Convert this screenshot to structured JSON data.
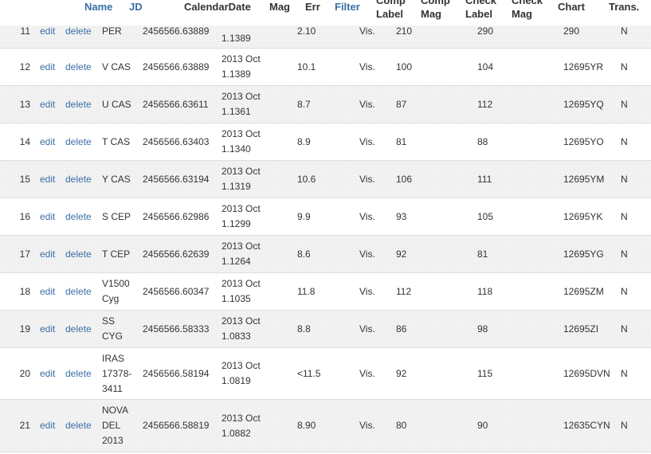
{
  "columns": {
    "name": "Name",
    "jd": "JD",
    "calendar_date": "CalendarDate",
    "mag": "Mag",
    "err": "Err",
    "filter": "Filter",
    "comp_label": [
      "Comp",
      "Label"
    ],
    "comp_mag": [
      "Comp",
      "Mag"
    ],
    "check_label": [
      "Check",
      "Label"
    ],
    "check_mag": [
      "Check",
      "Mag"
    ],
    "chart": "Chart",
    "trans": "Trans."
  },
  "actions": {
    "edit": "edit",
    "delete": "delete"
  },
  "rows": [
    {
      "num": "11",
      "name": [
        "PER"
      ],
      "jd": "2456566.63889",
      "date": [
        "",
        "1.1389"
      ],
      "mag": "2.10",
      "filter": "Vis.",
      "comp": "210",
      "check": "290",
      "chart": "290",
      "trans": "N"
    },
    {
      "num": "12",
      "name": [
        "V CAS"
      ],
      "jd": "2456566.63889",
      "date": [
        "2013 Oct",
        "1.1389"
      ],
      "mag": "10.1",
      "filter": "Vis.",
      "comp": "100",
      "check": "104",
      "chart": "12695YR",
      "trans": "N"
    },
    {
      "num": "13",
      "name": [
        "U CAS"
      ],
      "jd": "2456566.63611",
      "date": [
        "2013 Oct",
        "1.1361"
      ],
      "mag": "8.7",
      "filter": "Vis.",
      "comp": "87",
      "check": "112",
      "chart": "12695YQ",
      "trans": "N"
    },
    {
      "num": "14",
      "name": [
        "T CAS"
      ],
      "jd": "2456566.63403",
      "date": [
        "2013 Oct",
        "1.1340"
      ],
      "mag": "8.9",
      "filter": "Vis.",
      "comp": "81",
      "check": "88",
      "chart": "12695YO",
      "trans": "N"
    },
    {
      "num": "15",
      "name": [
        "Y CAS"
      ],
      "jd": "2456566.63194",
      "date": [
        "2013 Oct",
        "1.1319"
      ],
      "mag": "10.6",
      "filter": "Vis.",
      "comp": "106",
      "check": "111",
      "chart": "12695YM",
      "trans": "N"
    },
    {
      "num": "16",
      "name": [
        "S CEP"
      ],
      "jd": "2456566.62986",
      "date": [
        "2013 Oct",
        "1.1299"
      ],
      "mag": "9.9",
      "filter": "Vis.",
      "comp": "93",
      "check": "105",
      "chart": "12695YK",
      "trans": "N"
    },
    {
      "num": "17",
      "name": [
        "T CEP"
      ],
      "jd": "2456566.62639",
      "date": [
        "2013 Oct",
        "1.1264"
      ],
      "mag": "8.6",
      "filter": "Vis.",
      "comp": "92",
      "check": "81",
      "chart": "12695YG",
      "trans": "N"
    },
    {
      "num": "18",
      "name": [
        "V1500",
        "Cyg"
      ],
      "jd": "2456566.60347",
      "date": [
        "2013 Oct",
        "1.1035"
      ],
      "mag": "11.8",
      "filter": "Vis.",
      "comp": "112",
      "check": "118",
      "chart": "12695ZM",
      "trans": "N"
    },
    {
      "num": "19",
      "name": [
        "SS",
        "CYG"
      ],
      "jd": "2456566.58333",
      "date": [
        "2013 Oct",
        "1.0833"
      ],
      "mag": "8.8",
      "filter": "Vis.",
      "comp": "86",
      "check": "98",
      "chart": "12695ZI",
      "trans": "N"
    },
    {
      "num": "20",
      "name": [
        "IRAS",
        "17378-",
        "3411"
      ],
      "jd": "2456566.58194",
      "date": [
        "2013 Oct",
        "1.0819"
      ],
      "mag": "<11.5",
      "filter": "Vis.",
      "comp": "92",
      "check": "115",
      "chart": "12695DVN",
      "trans": "N"
    },
    {
      "num": "21",
      "name": [
        "NOVA",
        "DEL",
        "2013"
      ],
      "jd": "2456566.58819",
      "date": [
        "2013 Oct",
        "1.0882"
      ],
      "mag": "8.90",
      "filter": "Vis.",
      "comp": "80",
      "check": "90",
      "chart": "12635CYN",
      "trans": "N"
    }
  ]
}
